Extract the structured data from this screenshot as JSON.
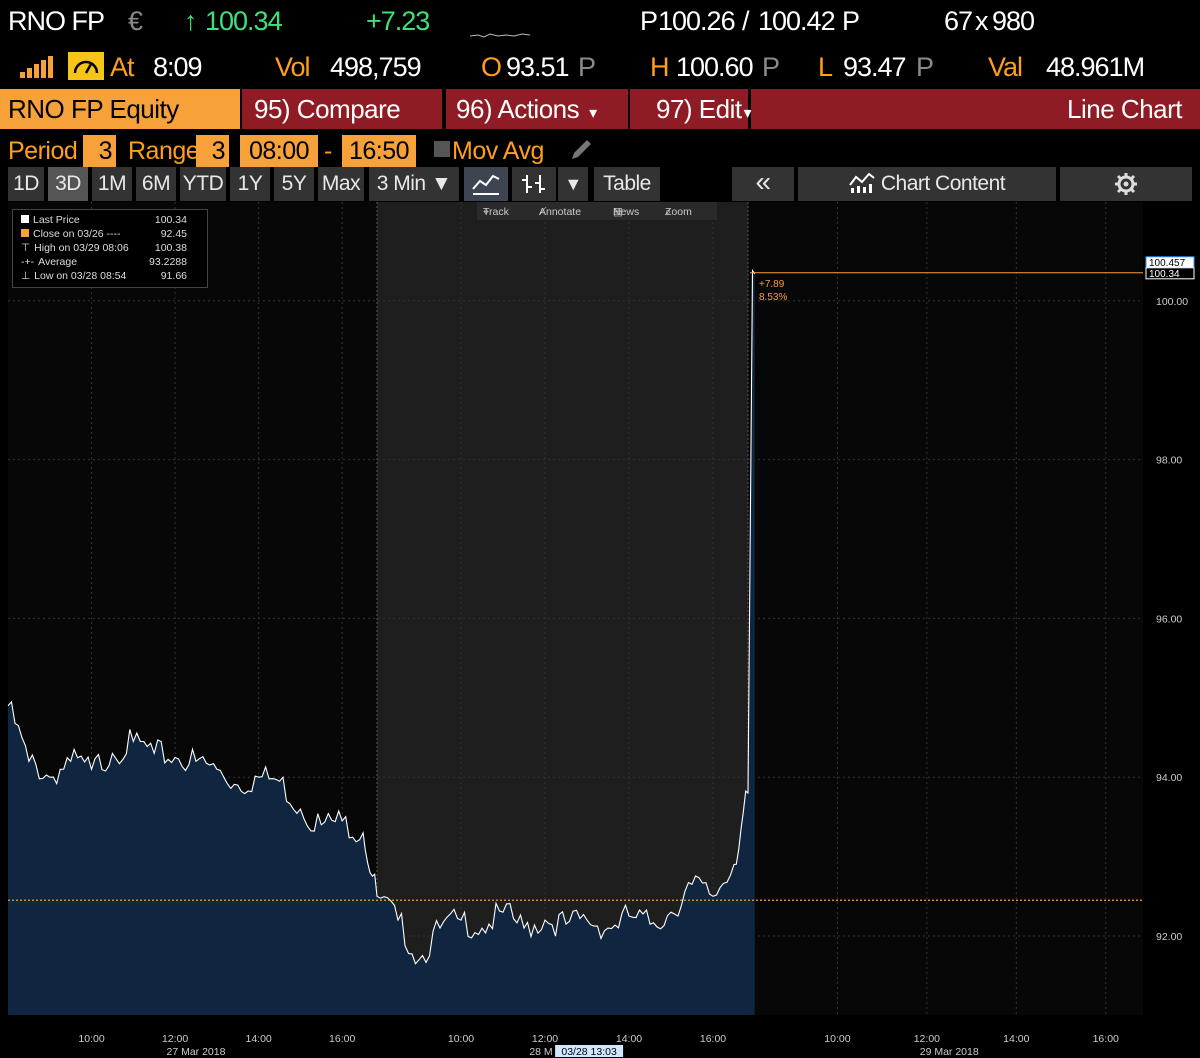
{
  "quote": {
    "ticker": "RNO FP",
    "currency": "€",
    "arrow": "↑",
    "last": "100.34",
    "change": "+7.23",
    "bidask_prefix": "P",
    "bid": "100.26",
    "slash": "/",
    "ask": "100.42",
    "ask_suffix": "P",
    "size_bid": "67",
    "size_x": "x",
    "size_ask": "980",
    "at_label": "At",
    "time": "8:09",
    "vol_label": "Vol",
    "volume": "498,759",
    "open_label": "O",
    "open": "93.51",
    "open_suffix": "P",
    "high_label": "H",
    "high": "100.60",
    "high_suffix": "P",
    "low_label": "L",
    "low": "93.47",
    "low_suffix": "P",
    "val_label": "Val",
    "value": "48.961M"
  },
  "menu": {
    "security": "RNO FP Equity",
    "compare": "95) Compare",
    "actions": "96) Actions",
    "edit": "97) Edit",
    "chart_type": "Line Chart"
  },
  "period": {
    "period_label": "Period",
    "period_value": "3",
    "range_label": "Range",
    "range_value": "3",
    "start": "08:00",
    "dash": "-",
    "end": "16:50",
    "movavg": "Mov Avg"
  },
  "toolbar": {
    "ranges": [
      "1D",
      "3D",
      "1M",
      "6M",
      "YTD",
      "1Y",
      "5Y",
      "Max"
    ],
    "active_range": "3D",
    "interval": "3 Min",
    "table": "Table",
    "collapse": "«",
    "chart_content": "Chart Content"
  },
  "chart_tools": {
    "track": "Track",
    "annotate": "Annotate",
    "news": "News",
    "zoom": "Zoom"
  },
  "legend": {
    "items": [
      {
        "label": "Last Price",
        "value": "100.34"
      },
      {
        "label": "Close on 03/26 ----",
        "value": "92.45"
      },
      {
        "label": "High on 03/29 08:06",
        "value": "100.38"
      },
      {
        "label": "Average",
        "value": "93.2288"
      },
      {
        "label": "Low on 03/28 08:54",
        "value": "91.66"
      }
    ]
  },
  "colors": {
    "background": "#000000",
    "orange": "#f7a13a",
    "red": "#8f1b24",
    "green": "#3fe07a",
    "area_fill": "#10253f",
    "line": "#ffffff",
    "session_shade": "#1e1e1e"
  },
  "chart_data": {
    "type": "area",
    "y_range": [
      91.0,
      92.8
    ],
    "ylim": [
      91.0,
      93.0
    ],
    "yticks": [
      "92.00",
      "94.00",
      "96.00",
      "98.00",
      "100.00"
    ],
    "ytick_values": [
      92,
      94,
      96,
      98,
      100
    ],
    "reference_line": {
      "label": "Close on 03/26",
      "value": 92.45
    },
    "last_price_label": "100.34",
    "high_label": "100.457",
    "annotation_change": "+7.89",
    "annotation_pct": "8.53%",
    "x_tick_labels": [
      "10:00",
      "12:00",
      "14:00",
      "16:00",
      "10:00",
      "12:00",
      "14:00",
      "16:00",
      "10:00",
      "12:00",
      "14:00",
      "16:00"
    ],
    "day_labels": [
      "27 Mar 2018",
      "28 M",
      "29 Mar 2018"
    ],
    "cursor_label": "03/28 13:03",
    "sessions": [
      {
        "day": "27 Mar 2018",
        "time": [
          "08:00",
          "08:30",
          "09:00",
          "09:30",
          "10:00",
          "10:30",
          "11:00",
          "11:30",
          "12:00",
          "12:30",
          "13:00",
          "13:30",
          "14:00",
          "14:30",
          "15:00",
          "15:30",
          "16:00",
          "16:30",
          "16:50"
        ],
        "price": [
          94.9,
          94.2,
          94.0,
          94.2,
          94.1,
          94.3,
          94.45,
          94.3,
          94.25,
          94.2,
          94.1,
          93.9,
          94.0,
          93.95,
          93.6,
          93.4,
          93.45,
          93.3,
          92.5
        ]
      },
      {
        "day": "28 Mar 2018",
        "time": [
          "08:00",
          "08:30",
          "09:00",
          "09:30",
          "10:00",
          "10:30",
          "11:00",
          "11:30",
          "12:00",
          "12:30",
          "13:00",
          "13:30",
          "14:00",
          "14:30",
          "15:00",
          "15:30",
          "16:00",
          "16:30",
          "16:50"
        ],
        "price": [
          92.5,
          92.2,
          91.7,
          92.1,
          92.2,
          92.1,
          92.3,
          92.1,
          92.2,
          92.15,
          92.2,
          92.1,
          92.25,
          92.15,
          92.3,
          92.65,
          92.5,
          92.9,
          93.8
        ]
      },
      {
        "day": "29 Mar 2018",
        "time": [
          "08:00",
          "08:06",
          "08:09"
        ],
        "price": [
          93.8,
          100.38,
          100.34
        ]
      }
    ]
  }
}
